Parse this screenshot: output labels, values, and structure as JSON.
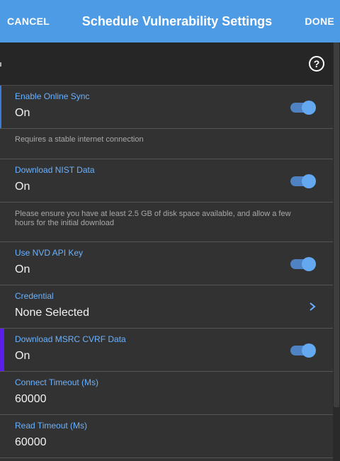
{
  "header": {
    "cancel_label": "CANCEL",
    "title": "Schedule Vulnerability Settings",
    "done_label": "DONE"
  },
  "panel": {
    "help_icon": "help-circle-icon",
    "help_glyph": "?"
  },
  "settings": {
    "online_sync": {
      "label": "Enable Online Sync",
      "value": "On",
      "enabled": true
    },
    "online_sync_note": "Requires a stable internet connection",
    "nist": {
      "label": "Download NIST Data",
      "value": "On",
      "enabled": true
    },
    "nist_note": "Please ensure you have at least 2.5 GB of disk space available, and allow a few hours for the initial download",
    "nvd_api_key": {
      "label": "Use NVD API Key",
      "value": "On",
      "enabled": true
    },
    "credential": {
      "label": "Credential",
      "value": "None Selected"
    },
    "msrc": {
      "label": "Download MSRC CVRF Data",
      "value": "On",
      "enabled": true
    },
    "connect_timeout": {
      "label": "Connect Timeout (Ms)",
      "value": "60000"
    },
    "read_timeout": {
      "label": "Read Timeout (Ms)",
      "value": "60000"
    }
  },
  "colors": {
    "header_bg": "#4e9be5",
    "label_blue": "#6ab2ff",
    "panel_bg": "#323232",
    "focus_accent": "#5b1ee6"
  }
}
